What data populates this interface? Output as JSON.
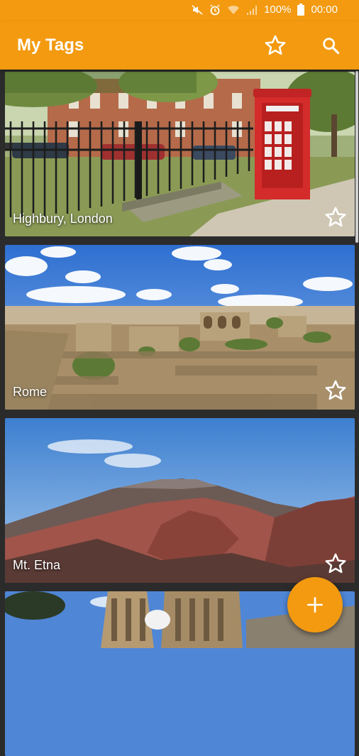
{
  "status_bar": {
    "battery": "100%",
    "time": "00:00"
  },
  "app_bar": {
    "title": "My Tags",
    "icons": [
      "star-outline-icon",
      "search-icon"
    ]
  },
  "tags": [
    {
      "label": "Highbury, London",
      "favorite": false
    },
    {
      "label": "Rome",
      "favorite": false
    },
    {
      "label": "Mt. Etna",
      "favorite": false
    },
    {
      "label": "",
      "favorite": false
    }
  ],
  "fab": {
    "icon": "plus-icon"
  },
  "colors": {
    "accent": "#f39a10",
    "background": "#2b2b2b"
  }
}
